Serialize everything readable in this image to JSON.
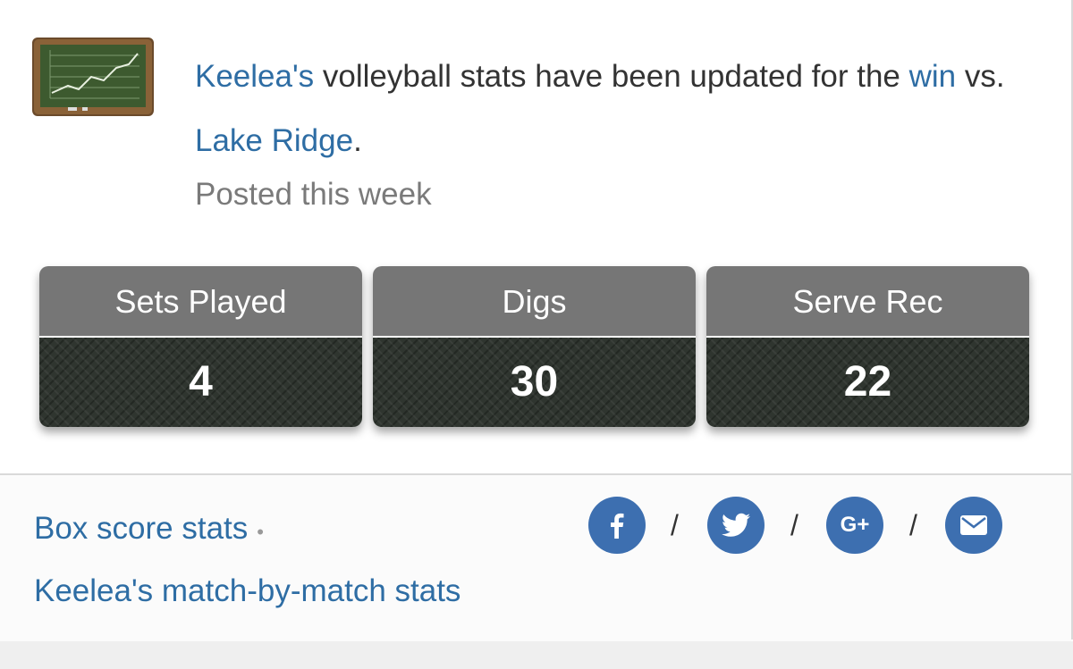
{
  "post": {
    "player_name": "Keelea's",
    "headline_mid": " volleyball stats have been updated for the ",
    "result_link": "win",
    "vs_text": " vs. ",
    "opponent": "Lake Ridge",
    "period": ".",
    "posted": "Posted this week"
  },
  "stats": [
    {
      "label": "Sets Played",
      "value": "4"
    },
    {
      "label": "Digs",
      "value": "30"
    },
    {
      "label": "Serve Rec",
      "value": "22"
    }
  ],
  "footer": {
    "box_score_link": "Box score stats",
    "separator": "•",
    "match_link": "Keelea's match-by-match stats",
    "share_separator": "/",
    "share_icons": [
      "facebook-icon",
      "twitter-icon",
      "google-plus-icon",
      "email-icon"
    ],
    "google_plus_text": "G+"
  },
  "colors": {
    "link": "#2e6da4",
    "share_circle": "#3d6fb0",
    "stat_header": "#767676",
    "stat_body": "#2f352f"
  }
}
